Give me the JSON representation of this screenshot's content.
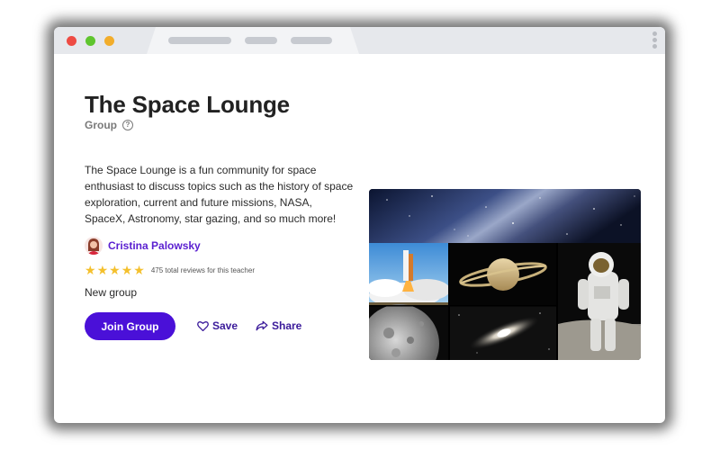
{
  "group": {
    "title": "The Space Lounge",
    "type_label": "Group",
    "description": "The Space Lounge is a fun community for space enthusiast to discuss topics such as the history of space exploration, current and future missions, NASA, SpaceX, Astronomy, star gazing, and so much more!",
    "teacher_name": "Cristina Palowsky",
    "rating_stars": 5,
    "reviews_text": "475 total reviews for this teacher",
    "status": "New group"
  },
  "actions": {
    "join_label": "Join Group",
    "save_label": "Save",
    "share_label": "Share"
  },
  "icons": {
    "help": "question-circle-icon",
    "heart": "heart-icon",
    "share": "share-arrow-icon",
    "star": "star-icon"
  },
  "colors": {
    "primary": "#4a10d8",
    "link": "#5a1fd0",
    "star": "#f4c02d"
  }
}
